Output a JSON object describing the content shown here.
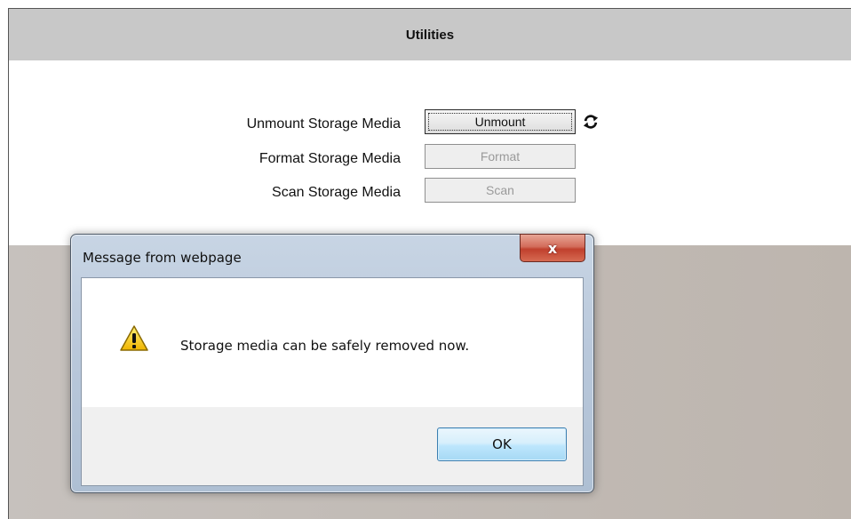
{
  "page": {
    "title": "Utilities"
  },
  "rows": [
    {
      "label": "Unmount Storage Media",
      "button": "Unmount",
      "enabled": true
    },
    {
      "label": "Format Storage Media",
      "button": "Format",
      "enabled": false
    },
    {
      "label": "Scan Storage Media",
      "button": "Scan",
      "enabled": false
    }
  ],
  "icons": {
    "refresh": "refresh-icon",
    "warning": "warning-icon",
    "close": "close-icon"
  },
  "dialog": {
    "title": "Message from webpage",
    "close_label": "x",
    "message": "Storage media can be safely removed now.",
    "ok_label": "OK"
  },
  "colors": {
    "titlebar": "#c8c8c8",
    "disabled_text": "#9a9a9a",
    "close_red": "#c0402d",
    "ok_blue": "#3c7fb1"
  }
}
